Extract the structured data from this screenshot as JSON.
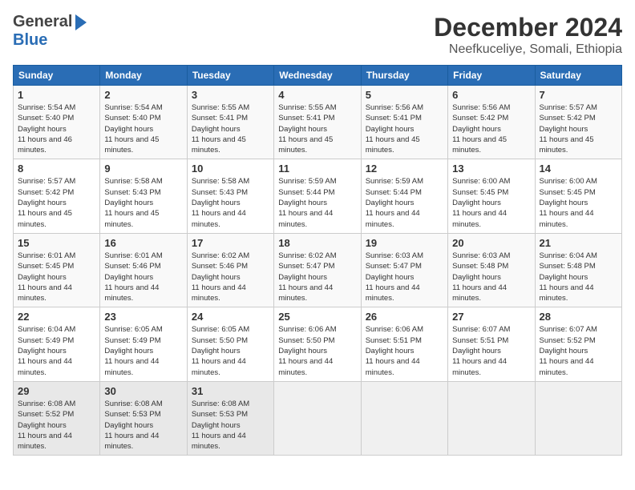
{
  "header": {
    "logo_general": "General",
    "logo_blue": "Blue",
    "month_title": "December 2024",
    "location": "Neefkuceliye, Somali, Ethiopia"
  },
  "days_of_week": [
    "Sunday",
    "Monday",
    "Tuesday",
    "Wednesday",
    "Thursday",
    "Friday",
    "Saturday"
  ],
  "weeks": [
    [
      {
        "day": 1,
        "sunrise": "5:54 AM",
        "sunset": "5:40 PM",
        "daylight": "11 hours and 46 minutes."
      },
      {
        "day": 2,
        "sunrise": "5:54 AM",
        "sunset": "5:40 PM",
        "daylight": "11 hours and 45 minutes."
      },
      {
        "day": 3,
        "sunrise": "5:55 AM",
        "sunset": "5:41 PM",
        "daylight": "11 hours and 45 minutes."
      },
      {
        "day": 4,
        "sunrise": "5:55 AM",
        "sunset": "5:41 PM",
        "daylight": "11 hours and 45 minutes."
      },
      {
        "day": 5,
        "sunrise": "5:56 AM",
        "sunset": "5:41 PM",
        "daylight": "11 hours and 45 minutes."
      },
      {
        "day": 6,
        "sunrise": "5:56 AM",
        "sunset": "5:42 PM",
        "daylight": "11 hours and 45 minutes."
      },
      {
        "day": 7,
        "sunrise": "5:57 AM",
        "sunset": "5:42 PM",
        "daylight": "11 hours and 45 minutes."
      }
    ],
    [
      {
        "day": 8,
        "sunrise": "5:57 AM",
        "sunset": "5:42 PM",
        "daylight": "11 hours and 45 minutes."
      },
      {
        "day": 9,
        "sunrise": "5:58 AM",
        "sunset": "5:43 PM",
        "daylight": "11 hours and 45 minutes."
      },
      {
        "day": 10,
        "sunrise": "5:58 AM",
        "sunset": "5:43 PM",
        "daylight": "11 hours and 44 minutes."
      },
      {
        "day": 11,
        "sunrise": "5:59 AM",
        "sunset": "5:44 PM",
        "daylight": "11 hours and 44 minutes."
      },
      {
        "day": 12,
        "sunrise": "5:59 AM",
        "sunset": "5:44 PM",
        "daylight": "11 hours and 44 minutes."
      },
      {
        "day": 13,
        "sunrise": "6:00 AM",
        "sunset": "5:45 PM",
        "daylight": "11 hours and 44 minutes."
      },
      {
        "day": 14,
        "sunrise": "6:00 AM",
        "sunset": "5:45 PM",
        "daylight": "11 hours and 44 minutes."
      }
    ],
    [
      {
        "day": 15,
        "sunrise": "6:01 AM",
        "sunset": "5:45 PM",
        "daylight": "11 hours and 44 minutes."
      },
      {
        "day": 16,
        "sunrise": "6:01 AM",
        "sunset": "5:46 PM",
        "daylight": "11 hours and 44 minutes."
      },
      {
        "day": 17,
        "sunrise": "6:02 AM",
        "sunset": "5:46 PM",
        "daylight": "11 hours and 44 minutes."
      },
      {
        "day": 18,
        "sunrise": "6:02 AM",
        "sunset": "5:47 PM",
        "daylight": "11 hours and 44 minutes."
      },
      {
        "day": 19,
        "sunrise": "6:03 AM",
        "sunset": "5:47 PM",
        "daylight": "11 hours and 44 minutes."
      },
      {
        "day": 20,
        "sunrise": "6:03 AM",
        "sunset": "5:48 PM",
        "daylight": "11 hours and 44 minutes."
      },
      {
        "day": 21,
        "sunrise": "6:04 AM",
        "sunset": "5:48 PM",
        "daylight": "11 hours and 44 minutes."
      }
    ],
    [
      {
        "day": 22,
        "sunrise": "6:04 AM",
        "sunset": "5:49 PM",
        "daylight": "11 hours and 44 minutes."
      },
      {
        "day": 23,
        "sunrise": "6:05 AM",
        "sunset": "5:49 PM",
        "daylight": "11 hours and 44 minutes."
      },
      {
        "day": 24,
        "sunrise": "6:05 AM",
        "sunset": "5:50 PM",
        "daylight": "11 hours and 44 minutes."
      },
      {
        "day": 25,
        "sunrise": "6:06 AM",
        "sunset": "5:50 PM",
        "daylight": "11 hours and 44 minutes."
      },
      {
        "day": 26,
        "sunrise": "6:06 AM",
        "sunset": "5:51 PM",
        "daylight": "11 hours and 44 minutes."
      },
      {
        "day": 27,
        "sunrise": "6:07 AM",
        "sunset": "5:51 PM",
        "daylight": "11 hours and 44 minutes."
      },
      {
        "day": 28,
        "sunrise": "6:07 AM",
        "sunset": "5:52 PM",
        "daylight": "11 hours and 44 minutes."
      }
    ],
    [
      {
        "day": 29,
        "sunrise": "6:08 AM",
        "sunset": "5:52 PM",
        "daylight": "11 hours and 44 minutes."
      },
      {
        "day": 30,
        "sunrise": "6:08 AM",
        "sunset": "5:53 PM",
        "daylight": "11 hours and 44 minutes."
      },
      {
        "day": 31,
        "sunrise": "6:08 AM",
        "sunset": "5:53 PM",
        "daylight": "11 hours and 44 minutes."
      },
      null,
      null,
      null,
      null
    ]
  ]
}
